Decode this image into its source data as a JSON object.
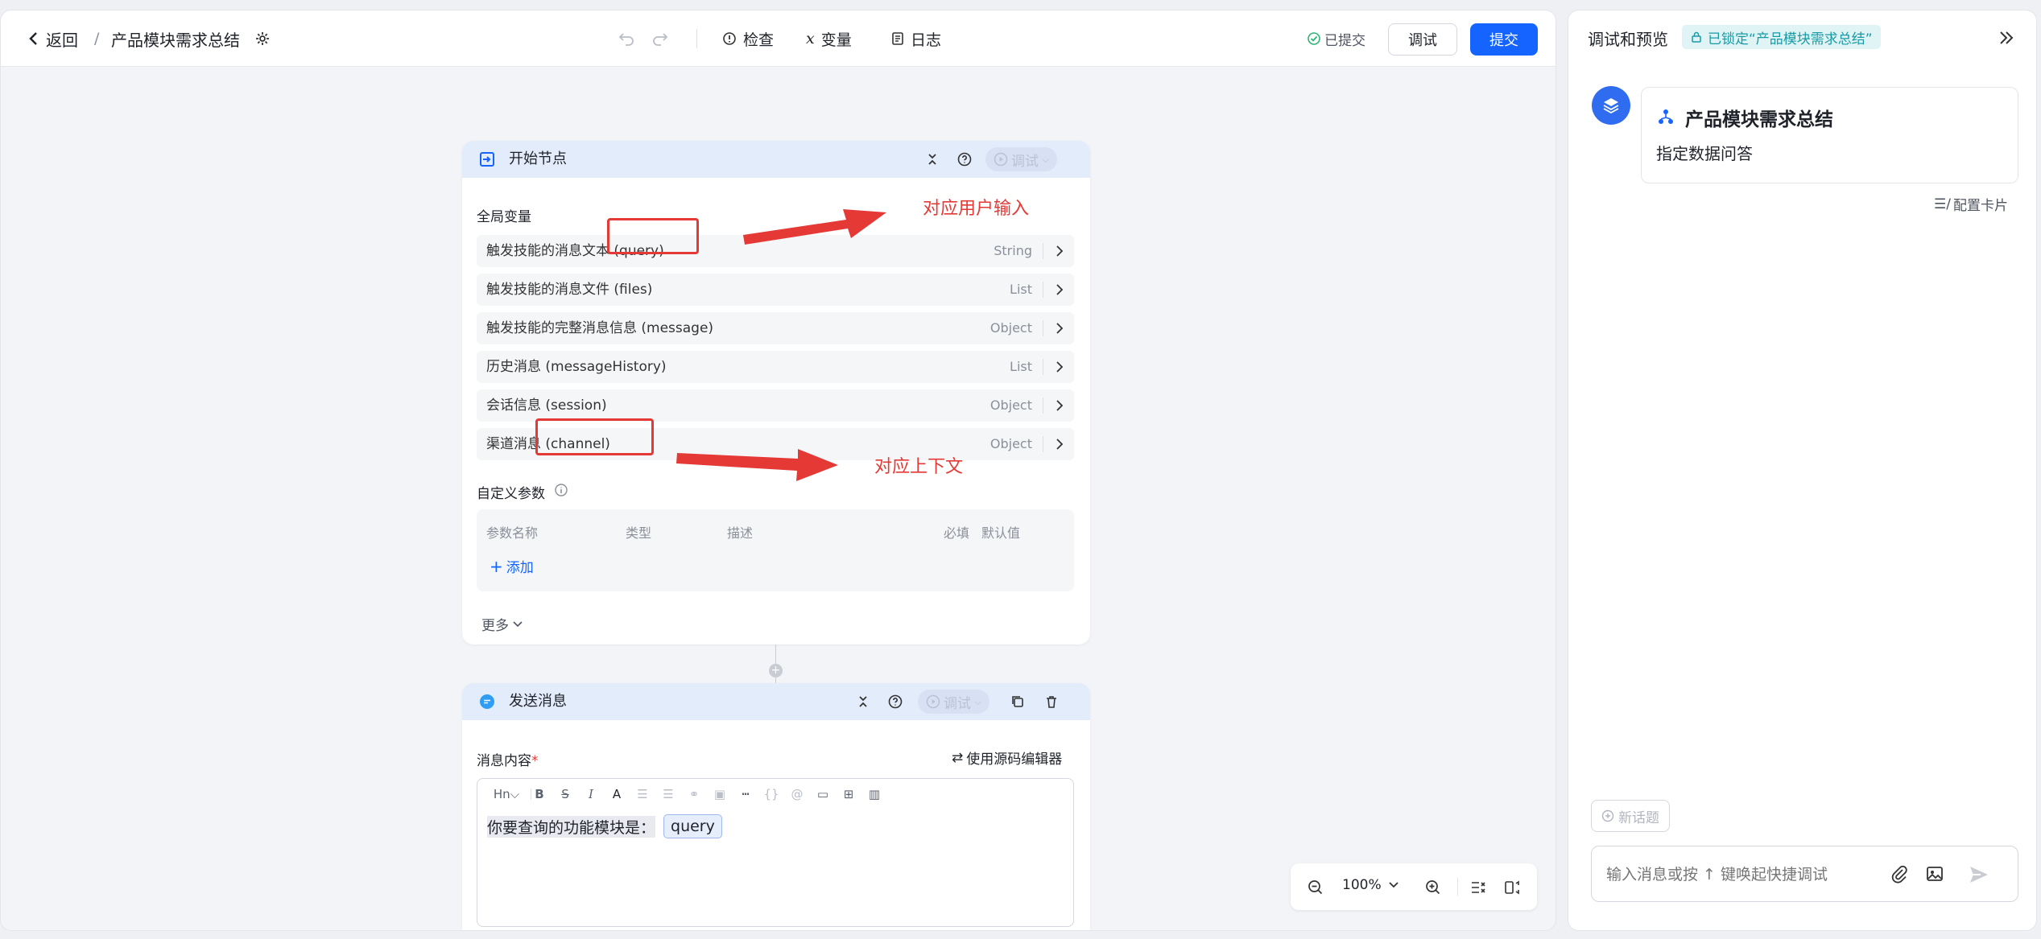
{
  "topbar": {
    "back_label": "返回",
    "separator": "/",
    "project_title": "产品模块需求总结",
    "check_label": "检查",
    "variables_label": "变量",
    "log_label": "日志",
    "submitted_status": "已提交",
    "debug_button": "调试",
    "submit_button": "提交"
  },
  "start_node": {
    "title": "开始节点",
    "debug_label": "调试",
    "global_vars_label": "全局变量",
    "variables": [
      {
        "name": "触发技能的消息文本 (query)",
        "type": "String"
      },
      {
        "name": "触发技能的消息文件 (files)",
        "type": "List"
      },
      {
        "name": "触发技能的完整消息信息 (message)",
        "type": "Object"
      },
      {
        "name": "历史消息 (messageHistory)",
        "type": "List"
      },
      {
        "name": "会话信息 (session)",
        "type": "Object"
      },
      {
        "name": "渠道消息 (channel)",
        "type": "Object"
      }
    ],
    "custom_params_label": "自定义参数",
    "param_columns": {
      "name": "参数名称",
      "type": "类型",
      "desc": "描述",
      "required": "必填",
      "default": "默认值"
    },
    "add_label": "添加",
    "more_label": "更多"
  },
  "annotations": {
    "user_input": "对应用户输入",
    "context": "对应上下文"
  },
  "send_node": {
    "title": "发送消息",
    "debug_label": "调试",
    "content_label": "消息内容",
    "required_mark": "*",
    "source_editor_label": "使用源码编辑器",
    "heading_tool": "Hn",
    "editor_text": "你要查询的功能模块是：",
    "query_chip": "query"
  },
  "zoom": {
    "level": "100%"
  },
  "side": {
    "title": "调试和预览",
    "locked_badge": "已锁定“产品模块需求总结”",
    "card_title": "产品模块需求总结",
    "card_subtitle": "指定数据问答",
    "config_card_label": "配置卡片",
    "new_topic_label": "新话题",
    "input_placeholder": "输入消息或按 ↑ 键唤起快捷调试"
  },
  "colors": {
    "accent": "#1664ff",
    "annotation": "#e53935",
    "success": "#2bb673",
    "node_header": "#e3ecfb"
  }
}
